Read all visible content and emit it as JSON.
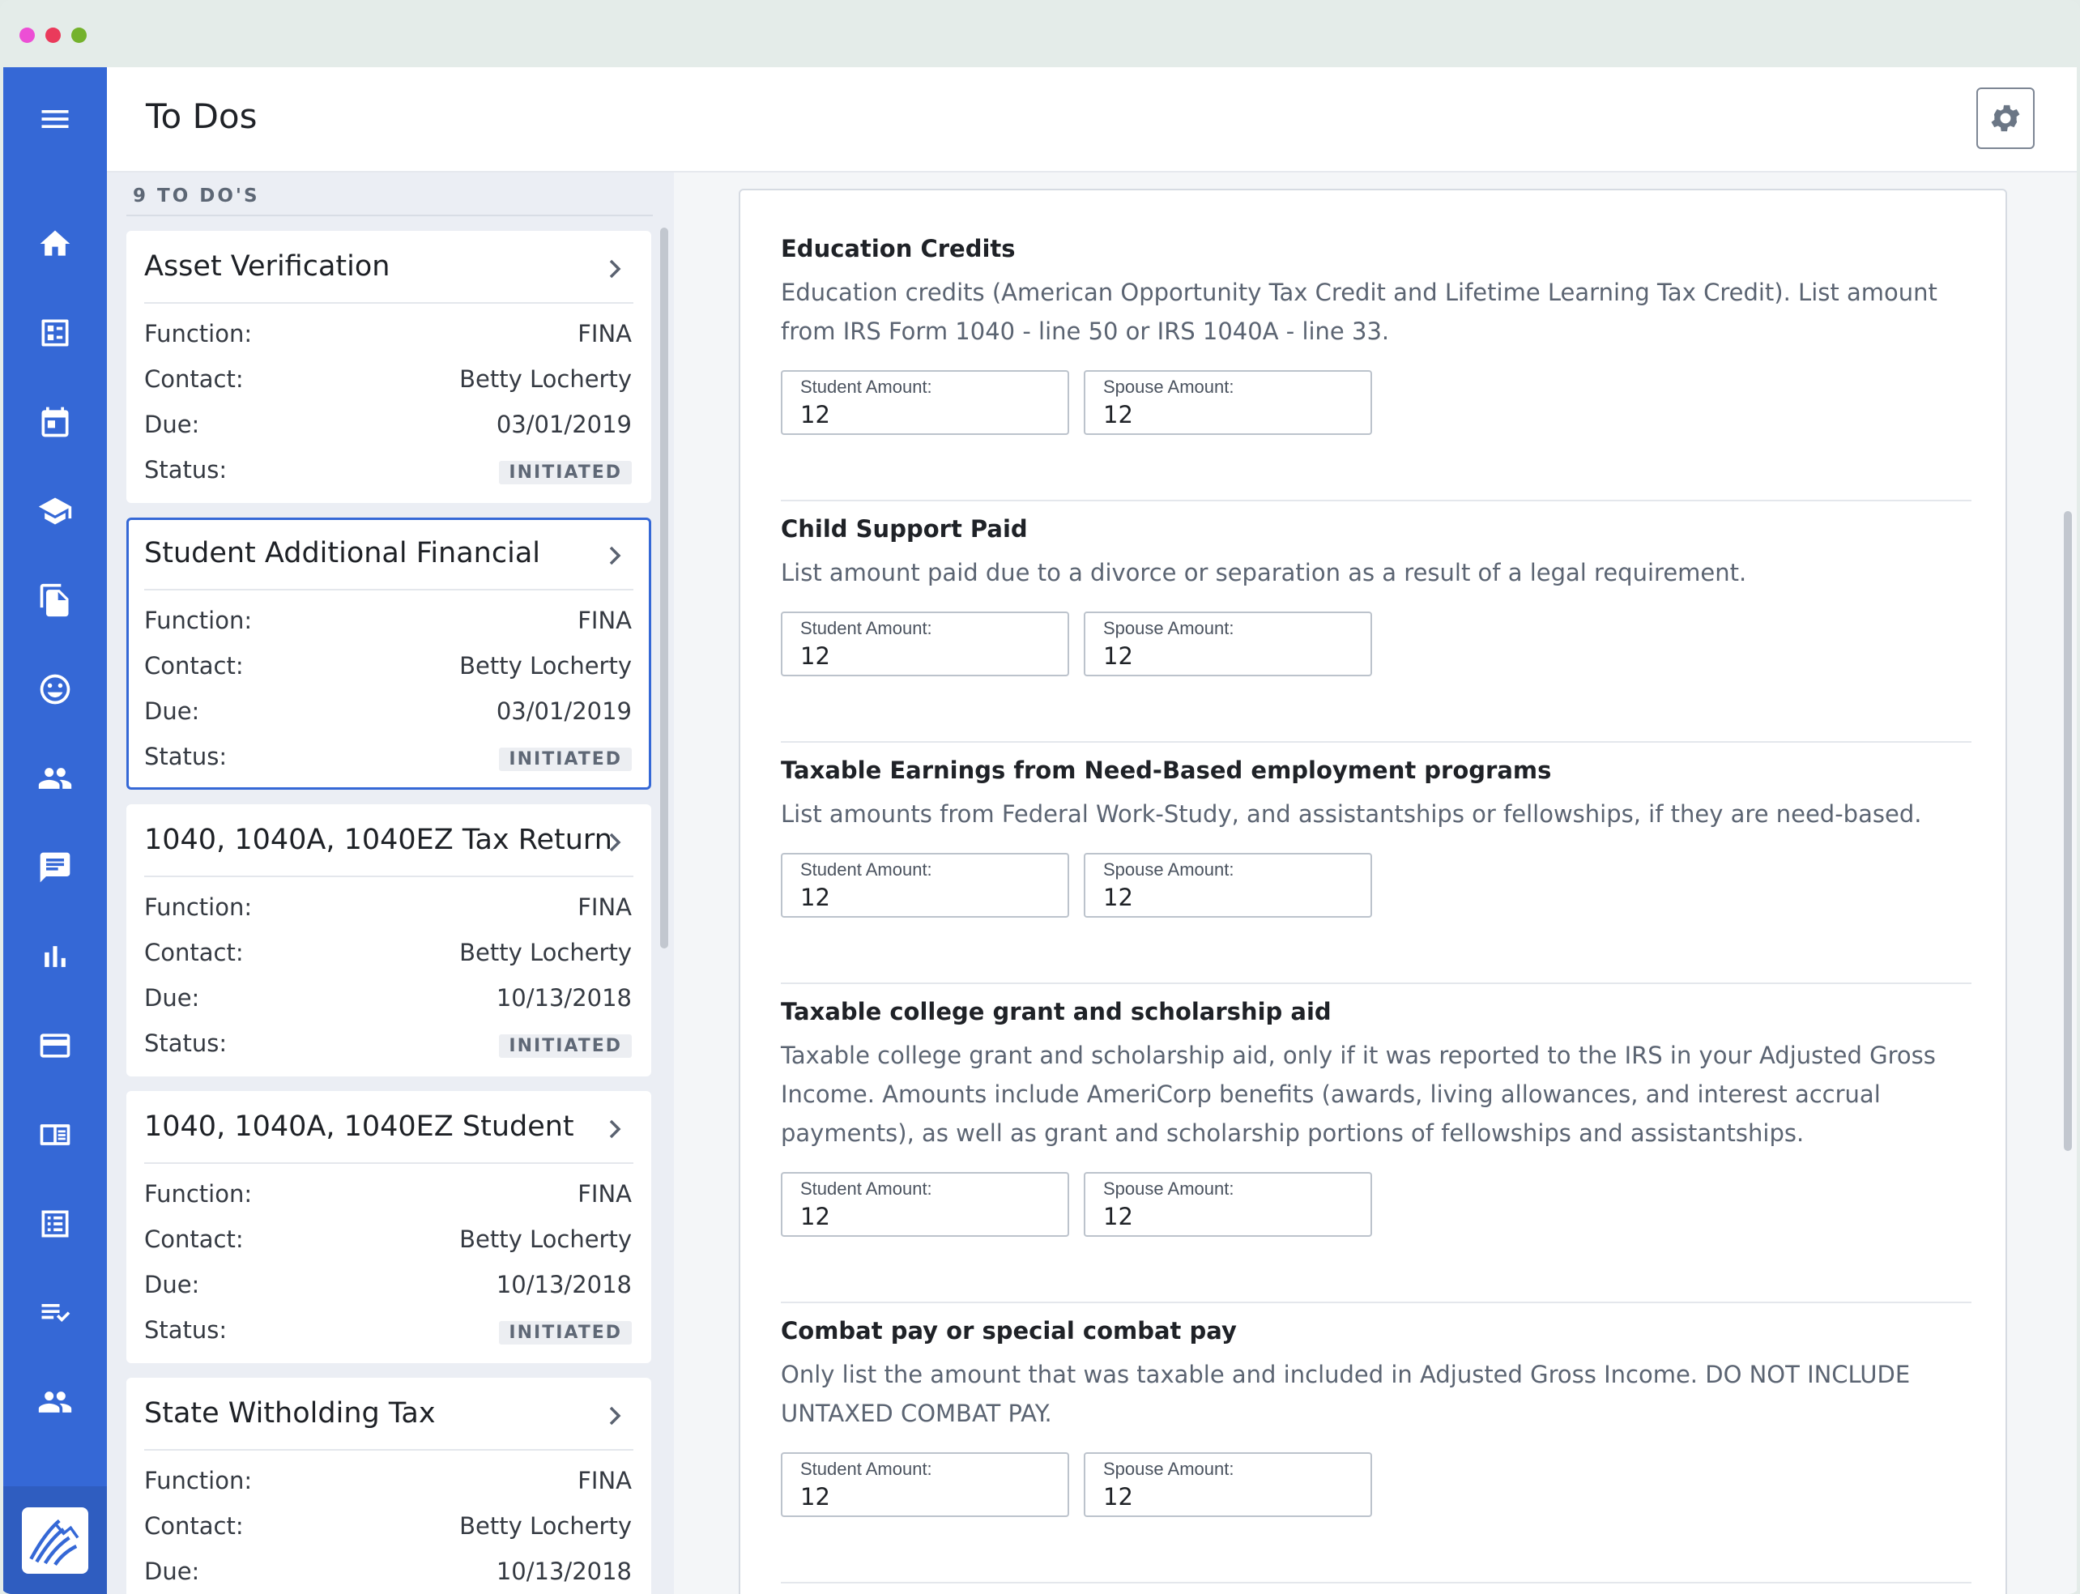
{
  "header": {
    "title": "To Dos"
  },
  "list": {
    "count_label": "9 TO DO'S",
    "field_labels": {
      "function": "Function:",
      "contact": "Contact:",
      "due": "Due:",
      "status": "Status:"
    },
    "items": [
      {
        "title": "Asset Verification",
        "function": "FINA",
        "contact": "Betty Locherty",
        "due": "03/01/2019",
        "status": "INITIATED"
      },
      {
        "title": "Student Additional Financial",
        "function": "FINA",
        "contact": "Betty Locherty",
        "due": "03/01/2019",
        "status": "INITIATED"
      },
      {
        "title": "1040, 1040A, 1040EZ Tax Return",
        "function": "FINA",
        "contact": "Betty Locherty",
        "due": "10/13/2018",
        "status": "INITIATED"
      },
      {
        "title": "1040, 1040A, 1040EZ Student",
        "function": "FINA",
        "contact": "Betty Locherty",
        "due": "10/13/2018",
        "status": "INITIATED"
      },
      {
        "title": "State Witholding Tax",
        "function": "FINA",
        "contact": "Betty Locherty",
        "due": "10/13/2018"
      }
    ]
  },
  "detail": {
    "student_label": "Student Amount:",
    "spouse_label": "Spouse Amount:",
    "sections": [
      {
        "title": "Education Credits",
        "description": "Education credits (American Opportunity Tax Credit and Lifetime Learning Tax Credit). List amount from IRS Form 1040 - line 50 or IRS 1040A - line 33.",
        "student_value": "12",
        "spouse_value": "12"
      },
      {
        "title": "Child Support Paid",
        "description": "List amount paid due to a divorce or separation as a result of a legal requirement.",
        "student_value": "12",
        "spouse_value": "12"
      },
      {
        "title": "Taxable Earnings from Need-Based employment programs",
        "description": "List amounts from Federal Work-Study, and assistantships or fellowships, if they are need-based.",
        "student_value": "12",
        "spouse_value": "12"
      },
      {
        "title": "Taxable college grant and scholarship aid",
        "description": "Taxable college grant and scholarship aid, only if it was reported to the IRS in your Adjusted Gross Income. Amounts include AmeriCorp benefits (awards, living allowances, and interest accrual payments), as well as grant and scholarship portions of fellowships and assistantships.",
        "student_value": "12",
        "spouse_value": "12"
      },
      {
        "title": "Combat pay or special combat pay",
        "description": "Only list the amount that was taxable and included in Adjusted Gross Income. DO NOT INCLUDE UNTAXED COMBAT PAY.",
        "student_value": "12",
        "spouse_value": "12"
      }
    ]
  },
  "nav": {
    "icons": [
      "menu-icon",
      "home-icon",
      "dashboard-icon",
      "calendar-icon",
      "graduation-cap-icon",
      "documents-icon",
      "smiley-icon",
      "people-icon",
      "chat-icon",
      "bar-chart-icon",
      "credit-card-icon",
      "book-icon",
      "list-icon",
      "checklist-icon",
      "people-icon"
    ]
  },
  "colors": {
    "accent": "#3568d6",
    "nav_background": "#3568d6"
  }
}
